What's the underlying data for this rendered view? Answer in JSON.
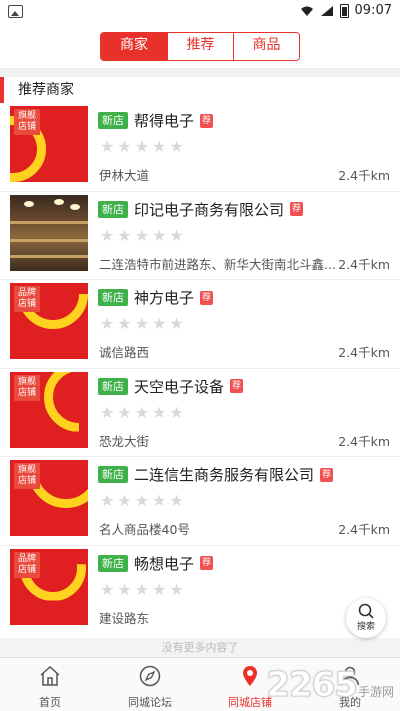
{
  "status_bar": {
    "time": "09:07"
  },
  "segments": [
    {
      "label": "商家",
      "active": true
    },
    {
      "label": "推荐",
      "active": false
    },
    {
      "label": "商品",
      "active": false
    }
  ],
  "section_title": "推荐商家",
  "shops": [
    {
      "badge": "新店",
      "name": "帮得电子",
      "rec": "荐",
      "address": "伊林大道",
      "distance": "2.4千km",
      "thumb_label": "旗舰店铺",
      "stars": 0
    },
    {
      "badge": "新店",
      "name": "印记电子商务有限公司",
      "rec": "荐",
      "address": "二连浩特市前进路东、新华大街南北斗鑫...",
      "distance": "2.4千km",
      "thumb_label": "",
      "stars": 0
    },
    {
      "badge": "新店",
      "name": "神方电子",
      "rec": "荐",
      "address": "诚信路西",
      "distance": "2.4千km",
      "thumb_label": "品牌店铺",
      "stars": 0
    },
    {
      "badge": "新店",
      "name": "天空电子设备",
      "rec": "荐",
      "address": "恐龙大街",
      "distance": "2.4千km",
      "thumb_label": "旗舰店铺",
      "stars": 0
    },
    {
      "badge": "新店",
      "name": "二连信生商务服务有限公司",
      "rec": "荐",
      "address": "名人商品楼40号",
      "distance": "2.4千km",
      "thumb_label": "旗舰店铺",
      "stars": 0
    },
    {
      "badge": "新店",
      "name": "畅想电子",
      "rec": "荐",
      "address": "建设路东",
      "distance": "",
      "thumb_label": "品牌店铺",
      "stars": 0
    }
  ],
  "more_text": "没有更多内容了",
  "search_fab_label": "搜索",
  "tabs": [
    {
      "label": "首页",
      "icon": "home-icon",
      "active": false
    },
    {
      "label": "同城论坛",
      "icon": "compass-icon",
      "active": false
    },
    {
      "label": "同城店铺",
      "icon": "map-pin-icon",
      "active": true
    },
    {
      "label": "我的",
      "icon": "user-icon",
      "active": false
    }
  ],
  "watermark": {
    "number": "2265",
    "text": "手游网"
  },
  "colors": {
    "accent": "#e8312a",
    "new_badge": "#3fb14a",
    "thumb_red": "#e02020",
    "thumb_yellow": "#ffd21f"
  }
}
